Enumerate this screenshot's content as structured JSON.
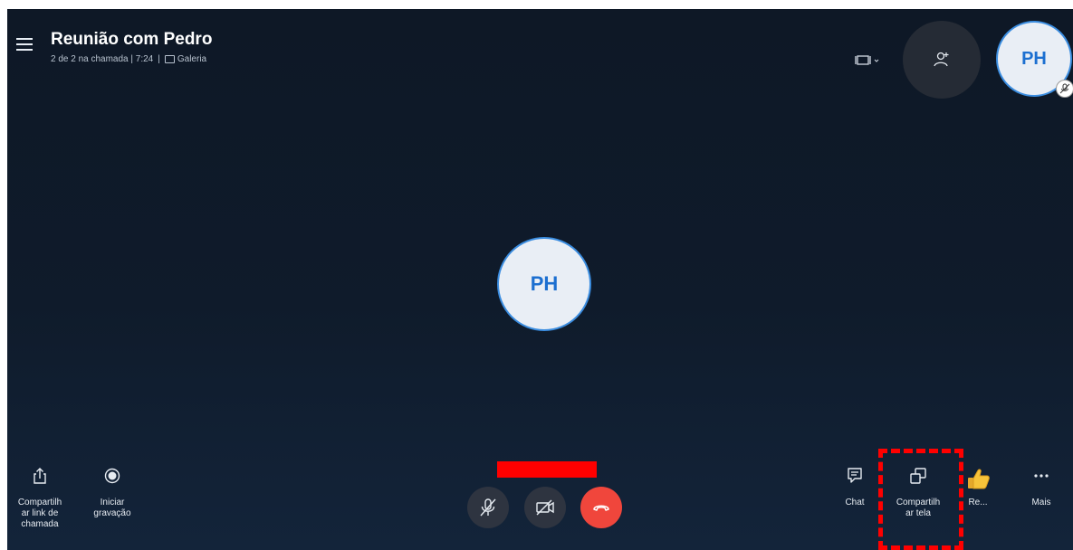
{
  "header": {
    "title": "Reunião com Pedro",
    "subtitle_status": "2 de 2 na chamada | 7:24",
    "subtitle_view": "Galeria"
  },
  "participants": {
    "self_initials": "PH",
    "main_initials": "PH"
  },
  "toolbar_left": {
    "share_link_label": "Compartilh ar link de chamada",
    "record_label": "Iniciar gravação"
  },
  "toolbar_right": {
    "chat_label": "Chat",
    "share_screen_label": "Compartilh ar tela",
    "react_label": "Re...",
    "more_label": "Mais"
  },
  "colors": {
    "background": "#0f1b2b",
    "end_call": "#f0463c",
    "accent": "#1c6fd0",
    "highlight": "#ff0000"
  },
  "icons": [
    "menu-icon",
    "gallery-icon",
    "layout-icon",
    "add-person-icon",
    "mic-off-icon",
    "share-icon",
    "record-icon",
    "video-off-icon",
    "end-call-icon",
    "chat-icon",
    "share-screen-icon",
    "thumbs-up-icon",
    "more-icon"
  ]
}
